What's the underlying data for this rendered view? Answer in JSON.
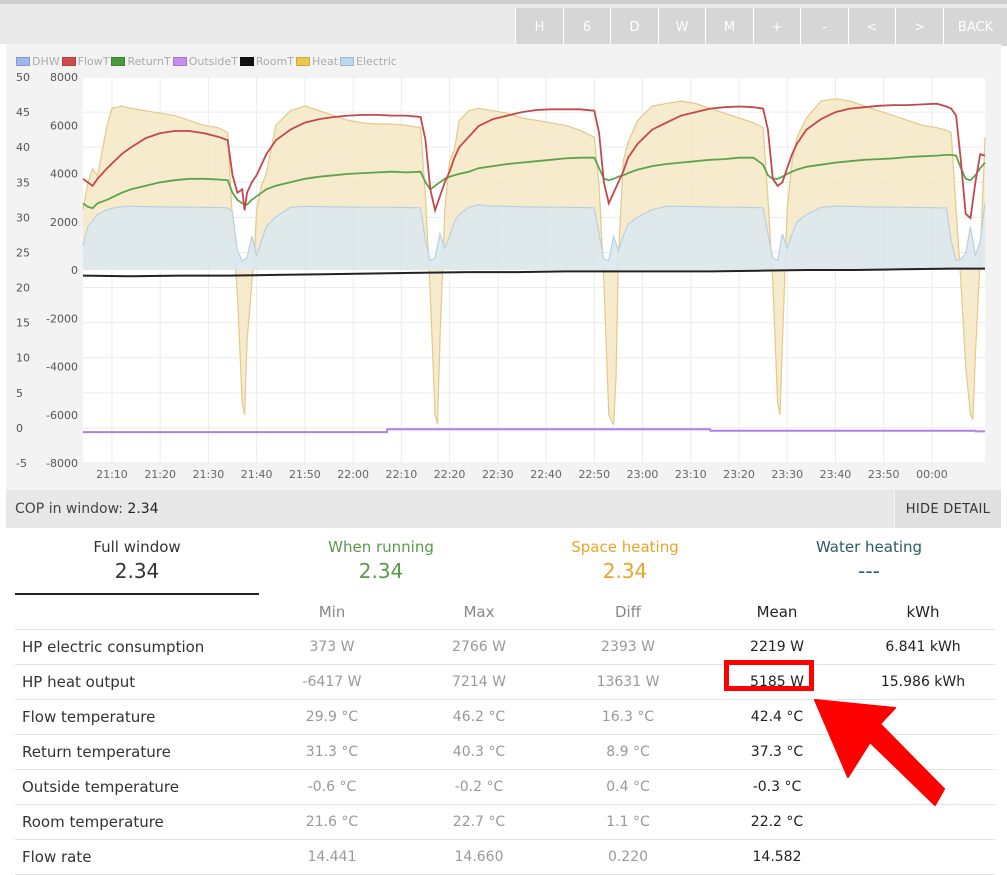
{
  "toolbar": {
    "buttons": [
      "H",
      "6",
      "D",
      "W",
      "M",
      "+",
      "-",
      "<",
      ">",
      "BACK"
    ]
  },
  "legend": [
    {
      "name": "DHW",
      "color": "#9db6ee",
      "border": "#6d8ee6"
    },
    {
      "name": "FlowT",
      "color": "#cd4c4c",
      "border": "#b53434"
    },
    {
      "name": "ReturnT",
      "color": "#4a9a3a",
      "border": "#3a8a2a"
    },
    {
      "name": "OutsideT",
      "color": "#c58ef0",
      "border": "#a56ed8"
    },
    {
      "name": "RoomT",
      "color": "#111111",
      "border": "#000000"
    },
    {
      "name": "Heat",
      "color": "#eec74c",
      "border": "#d9ae2a"
    },
    {
      "name": "Electric",
      "color": "#bcd6ee",
      "border": "#9dbbd8"
    }
  ],
  "chart_data": {
    "type": "line",
    "x_ticks": [
      "21:10",
      "21:20",
      "21:30",
      "21:40",
      "21:50",
      "22:00",
      "22:10",
      "22:20",
      "22:30",
      "22:40",
      "22:50",
      "23:00",
      "23:10",
      "23:20",
      "23:30",
      "23:40",
      "23:50",
      "00:00"
    ],
    "y_left_ticks": [
      "50",
      "45",
      "40",
      "35",
      "30",
      "25",
      "20",
      "15",
      "10",
      "5",
      "0",
      "-5"
    ],
    "y_right_ticks": [
      "8000",
      "6000",
      "4000",
      "2000",
      "0",
      "-2000",
      "-4000",
      "-6000",
      "-8000"
    ],
    "ylim_temp": [
      -5,
      50
    ],
    "ylim_power": [
      -8000,
      8000
    ],
    "xlim_minutes": [
      0,
      187
    ],
    "x_start_label": "21:04",
    "grid": true,
    "colors": {
      "flow": "#c4474b",
      "return": "#5aa44a",
      "outside": "#b07ee8",
      "room": "#222222",
      "heat_fill": "#f6e8c4",
      "heat_line": "#e3c98a",
      "elec_fill": "#dbe8ee",
      "elec_line": "#b8d0e0"
    },
    "series": [
      {
        "name": "FlowT",
        "x": [
          0,
          1,
          2,
          3,
          5,
          8,
          10,
          13,
          16,
          19,
          22,
          25,
          28,
          30,
          31,
          32,
          33,
          33.5,
          34,
          35,
          36,
          37,
          38,
          40,
          43,
          46,
          49,
          52,
          55,
          58,
          61,
          64,
          67,
          70,
          71,
          72,
          73,
          74,
          75,
          76,
          77,
          78,
          80,
          82,
          85,
          88,
          91,
          94,
          97,
          100,
          103,
          106,
          107,
          108,
          109,
          110,
          111,
          112,
          113,
          115,
          118,
          121,
          124,
          127,
          130,
          133,
          136,
          139,
          141,
          142,
          143,
          144,
          145,
          146,
          147,
          148,
          150,
          153,
          156,
          159,
          162,
          165,
          168,
          171,
          174,
          177,
          179,
          180,
          181,
          182,
          183,
          184,
          185,
          186,
          187
        ],
        "y": [
          35.5,
          35,
          34.5,
          35.5,
          37,
          39,
          40,
          41.3,
          42,
          42.3,
          42.3,
          42,
          41.5,
          41,
          36,
          33.5,
          34,
          31,
          33.5,
          35,
          36,
          37.5,
          39,
          41,
          42.5,
          43.5,
          44,
          44.3,
          44.5,
          44.6,
          44.6,
          44.5,
          44.5,
          44.3,
          41,
          34,
          31,
          33,
          35,
          36.5,
          38.5,
          40,
          41.5,
          43,
          44,
          44.5,
          45,
          45.3,
          45.4,
          45.4,
          45.4,
          45.2,
          42,
          35,
          32,
          33.5,
          35,
          36.5,
          38.5,
          40.5,
          42.5,
          43.5,
          44.5,
          45,
          45.5,
          45.7,
          45.8,
          45.7,
          45.5,
          42.5,
          35.5,
          34.5,
          35,
          37,
          39,
          40.5,
          42.5,
          44,
          45,
          45.5,
          45.7,
          45.9,
          46,
          46,
          46.1,
          46.2,
          45.8,
          45.5,
          44.5,
          38,
          30.5,
          29.9,
          35,
          39,
          38.8
        ]
      },
      {
        "name": "ReturnT",
        "x": [
          0,
          1,
          2,
          3,
          5,
          8,
          10,
          13,
          16,
          19,
          22,
          25,
          28,
          30,
          31,
          32,
          33,
          34,
          35,
          36,
          37,
          38,
          40,
          43,
          46,
          49,
          52,
          55,
          58,
          61,
          64,
          67,
          70,
          71,
          72,
          73,
          74,
          75,
          76,
          77,
          78,
          80,
          82,
          85,
          88,
          91,
          94,
          97,
          100,
          103,
          106,
          107,
          108,
          109,
          110,
          111,
          112,
          113,
          115,
          118,
          121,
          124,
          127,
          130,
          133,
          136,
          139,
          141,
          142,
          143,
          144,
          145,
          146,
          147,
          148,
          150,
          153,
          156,
          159,
          162,
          165,
          168,
          171,
          174,
          177,
          179,
          180,
          181,
          182,
          183,
          184,
          185,
          186,
          187
        ],
        "y": [
          32,
          31.5,
          31.3,
          32,
          32.5,
          33.5,
          34,
          34.5,
          35,
          35.3,
          35.5,
          35.5,
          35.4,
          35.3,
          33.5,
          32.5,
          32,
          31.8,
          32.5,
          33,
          33.5,
          34,
          34.5,
          35,
          35.5,
          35.8,
          36,
          36.2,
          36.3,
          36.4,
          36.5,
          36.4,
          36.5,
          35,
          34,
          34.5,
          35,
          35.5,
          35.8,
          36,
          36.2,
          36.5,
          37,
          37.3,
          37.6,
          37.8,
          38,
          38.2,
          38.4,
          38.5,
          38.5,
          37,
          35.5,
          35.3,
          35.5,
          35.8,
          36,
          36.3,
          36.8,
          37.3,
          37.6,
          37.8,
          38,
          38.2,
          38.3,
          38.5,
          38.5,
          37.5,
          36,
          35.5,
          35.5,
          35.8,
          36.2,
          36.5,
          36.8,
          37.2,
          37.5,
          37.8,
          38,
          38.2,
          38.3,
          38.4,
          38.6,
          38.7,
          38.8,
          38.9,
          38.9,
          38.8,
          37,
          35.5,
          35.3,
          36,
          37,
          37.8
        ]
      },
      {
        "name": "Heat",
        "x": [
          0,
          1,
          2,
          3,
          5,
          6,
          8,
          10,
          13,
          16,
          19,
          22,
          25,
          28,
          30,
          31,
          32,
          33,
          33.5,
          34,
          35,
          35.5,
          36,
          37,
          38,
          40,
          43,
          46,
          49,
          52,
          55,
          58,
          61,
          64,
          67,
          70,
          71,
          72,
          73,
          73.5,
          74,
          75,
          76,
          77,
          78,
          80,
          82,
          85,
          88,
          91,
          94,
          97,
          100,
          103,
          106,
          107,
          108,
          109,
          110,
          110.5,
          111,
          112,
          113,
          115,
          118,
          121,
          124,
          127,
          130,
          133,
          136,
          139,
          141,
          142,
          143,
          144,
          144.5,
          145,
          146,
          147,
          148,
          150,
          153,
          156,
          159,
          162,
          165,
          168,
          171,
          174,
          177,
          179,
          180,
          181,
          182,
          183,
          184,
          184.5,
          185,
          186,
          187
        ],
        "y": [
          2500,
          3600,
          4200,
          3900,
          6000,
          6700,
          6800,
          6700,
          6600,
          6500,
          6400,
          6200,
          6000,
          5900,
          5700,
          2000,
          -1000,
          -5500,
          -6000,
          -3000,
          -500,
          500,
          2500,
          3500,
          4000,
          6000,
          6600,
          6800,
          6600,
          6400,
          6200,
          6100,
          6050,
          6050,
          6000,
          5900,
          3000,
          -1000,
          -6000,
          -6400,
          -3000,
          2500,
          4500,
          5000,
          6200,
          6600,
          6700,
          6600,
          6500,
          6300,
          6200,
          6100,
          6000,
          5800,
          5500,
          3500,
          -500,
          -6000,
          -6417,
          -4500,
          500,
          4500,
          5300,
          6200,
          6800,
          6900,
          7000,
          6900,
          6700,
          6500,
          6300,
          6100,
          5900,
          3000,
          -500,
          -5500,
          -6000,
          -3000,
          2500,
          4500,
          5500,
          6300,
          7000,
          7100,
          7000,
          6800,
          6600,
          6400,
          6200,
          6000,
          5900,
          5800,
          5700,
          2500,
          -500,
          -4000,
          -6000,
          -6200,
          -3500,
          500,
          5500
        ]
      },
      {
        "name": "Electric",
        "x": [
          0,
          1,
          3,
          5,
          7,
          9,
          10,
          13,
          16,
          19,
          22,
          25,
          28,
          30,
          31,
          32,
          33,
          34,
          35,
          36,
          37,
          38,
          40,
          43,
          46,
          49,
          52,
          55,
          58,
          61,
          64,
          67,
          70,
          71,
          72,
          73,
          74,
          75,
          76,
          77,
          78,
          80,
          82,
          85,
          88,
          91,
          94,
          97,
          100,
          103,
          106,
          107,
          108,
          109,
          110,
          111,
          112,
          113,
          115,
          118,
          121,
          124,
          127,
          130,
          133,
          136,
          139,
          141,
          142,
          143,
          144,
          145,
          146,
          147,
          148,
          150,
          153,
          156,
          159,
          162,
          165,
          168,
          171,
          174,
          177,
          179,
          180,
          181,
          182,
          183,
          184,
          185,
          186,
          187
        ],
        "y": [
          1000,
          1800,
          2300,
          2500,
          2600,
          2640,
          2640,
          2630,
          2620,
          2610,
          2600,
          2600,
          2590,
          2580,
          2400,
          800,
          373,
          500,
          1400,
          600,
          1200,
          1800,
          2200,
          2600,
          2640,
          2630,
          2620,
          2610,
          2600,
          2600,
          2600,
          2590,
          2580,
          1200,
          400,
          500,
          1500,
          900,
          1400,
          2000,
          2300,
          2600,
          2700,
          2650,
          2640,
          2620,
          2610,
          2600,
          2600,
          2590,
          2580,
          1500,
          450,
          400,
          1400,
          800,
          1400,
          1900,
          2200,
          2500,
          2640,
          2640,
          2630,
          2620,
          2600,
          2600,
          2590,
          2580,
          1500,
          500,
          400,
          1500,
          900,
          1500,
          2000,
          2300,
          2600,
          2650,
          2640,
          2620,
          2610,
          2600,
          2600,
          2590,
          2580,
          2570,
          1200,
          400,
          450,
          700,
          1800,
          600,
          1200,
          2766
        ]
      },
      {
        "name": "RoomT",
        "x": [
          0,
          10,
          20,
          30,
          40,
          50,
          60,
          70,
          80,
          90,
          100,
          110,
          120,
          130,
          140,
          150,
          160,
          170,
          180,
          187
        ],
        "y": [
          21.7,
          21.6,
          21.7,
          21.7,
          21.8,
          21.9,
          22,
          22.1,
          22.2,
          22.2,
          22.3,
          22.3,
          22.3,
          22.3,
          22.4,
          22.5,
          22.5,
          22.6,
          22.7,
          22.7
        ]
      },
      {
        "name": "OutsideT",
        "x": [
          0,
          63,
          63.1,
          130,
          130.1,
          185,
          185.1,
          187
        ],
        "y": [
          -0.6,
          -0.6,
          -0.2,
          -0.2,
          -0.4,
          -0.4,
          -0.5,
          -0.5
        ]
      }
    ]
  },
  "cop": {
    "label": "COP in window:",
    "value": "2.34",
    "hide_detail": "HIDE DETAIL"
  },
  "tabs": [
    {
      "label": "Full window",
      "value": "2.34",
      "color": "#333333",
      "active": true
    },
    {
      "label": "When running",
      "value": "2.34",
      "color": "#5a9a4a"
    },
    {
      "label": "Space heating",
      "value": "2.34",
      "color": "#e8a626"
    },
    {
      "label": "Water heating",
      "value": "---",
      "color": "#2a5a6a"
    }
  ],
  "stats": {
    "headers": [
      "",
      "Min",
      "Max",
      "Diff",
      "Mean",
      "kWh"
    ],
    "rows": [
      [
        "HP electric consumption",
        "373 W",
        "2766 W",
        "2393 W",
        "2219 W",
        "6.841 kWh"
      ],
      [
        "HP heat output",
        "-6417 W",
        "7214 W",
        "13631 W",
        "5185 W",
        "15.986 kWh"
      ],
      [
        "Flow temperature",
        "29.9 °C",
        "46.2 °C",
        "16.3 °C",
        "42.4 °C",
        ""
      ],
      [
        "Return temperature",
        "31.3 °C",
        "40.3 °C",
        "8.9 °C",
        "37.3 °C",
        ""
      ],
      [
        "Outside temperature",
        "-0.6 °C",
        "-0.2 °C",
        "0.4 °C",
        "-0.3 °C",
        ""
      ],
      [
        "Room temperature",
        "21.6 °C",
        "22.7 °C",
        "1.1 °C",
        "22.2 °C",
        ""
      ],
      [
        "Flow rate",
        "14.441",
        "14.660",
        "0.220",
        "14.582",
        ""
      ]
    ]
  },
  "annotation": {
    "color": "#ff0000"
  }
}
